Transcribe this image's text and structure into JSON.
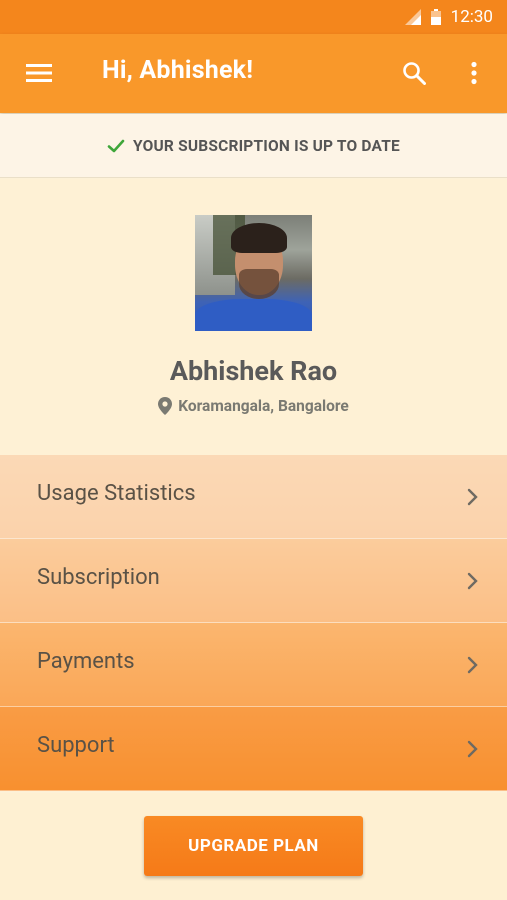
{
  "status_bar": {
    "time": "12:30",
    "icons": [
      "signal-icon",
      "battery-icon"
    ]
  },
  "app_bar": {
    "title": "Hi, Abhishek!",
    "icons": [
      "menu-icon",
      "search-icon",
      "more-vert-icon"
    ]
  },
  "subscription_banner": {
    "icon": "check-icon",
    "text": "YOUR SUBSCRIPTION IS UP TO DATE",
    "icon_color": "#3fa63a"
  },
  "profile": {
    "name": "Abhishek Rao",
    "location_icon": "location-pin-icon",
    "location": "Koramangala, Bangalore"
  },
  "menu": {
    "items": [
      {
        "label": "Usage Statistics",
        "icon": "chevron-right-icon"
      },
      {
        "label": "Subscription",
        "icon": "chevron-right-icon"
      },
      {
        "label": "Payments",
        "icon": "chevron-right-icon"
      },
      {
        "label": "Support",
        "icon": "chevron-right-icon"
      }
    ]
  },
  "footer": {
    "upgrade_button": "UPGRADE PLAN"
  },
  "colors": {
    "status_bar": "#f4861c",
    "app_bar": "#f9982a",
    "accent": "#f57a18",
    "background": "#fdf1d7"
  }
}
